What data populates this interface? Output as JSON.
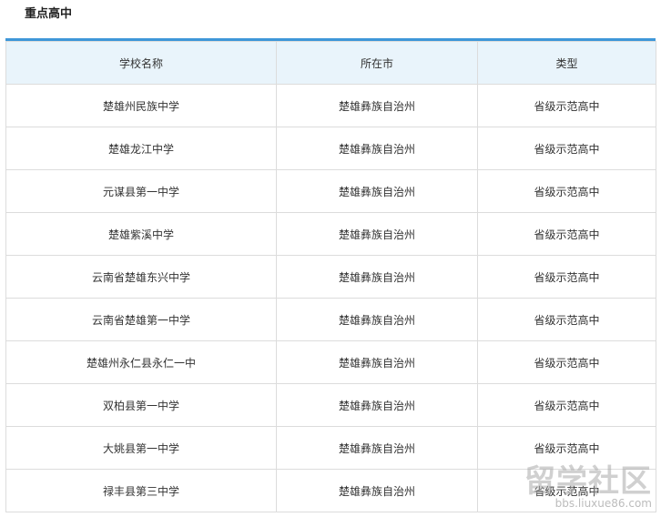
{
  "section": {
    "title": "重点高中"
  },
  "table": {
    "headers": [
      "学校名称",
      "所在市",
      "类型"
    ],
    "rows": [
      [
        "楚雄州民族中学",
        "楚雄彝族自治州",
        "省级示范高中"
      ],
      [
        "楚雄龙江中学",
        "楚雄彝族自治州",
        "省级示范高中"
      ],
      [
        "元谋县第一中学",
        "楚雄彝族自治州",
        "省级示范高中"
      ],
      [
        "楚雄紫溪中学",
        "楚雄彝族自治州",
        "省级示范高中"
      ],
      [
        "云南省楚雄东兴中学",
        "楚雄彝族自治州",
        "省级示范高中"
      ],
      [
        "云南省楚雄第一中学",
        "楚雄彝族自治州",
        "省级示范高中"
      ],
      [
        "楚雄州永仁县永仁一中",
        "楚雄彝族自治州",
        "省级示范高中"
      ],
      [
        "双柏县第一中学",
        "楚雄彝族自治州",
        "省级示范高中"
      ],
      [
        "大姚县第一中学",
        "楚雄彝族自治州",
        "省级示范高中"
      ],
      [
        "禄丰县第三中学",
        "楚雄彝族自治州",
        "省级示范高中"
      ]
    ]
  },
  "watermark": {
    "main": "留学社区",
    "sub": "bbs.liuxue86.com"
  },
  "colors": {
    "accent": "#3e97d8",
    "header_bg": "#e9f4fb",
    "border": "#dcdcdc"
  }
}
